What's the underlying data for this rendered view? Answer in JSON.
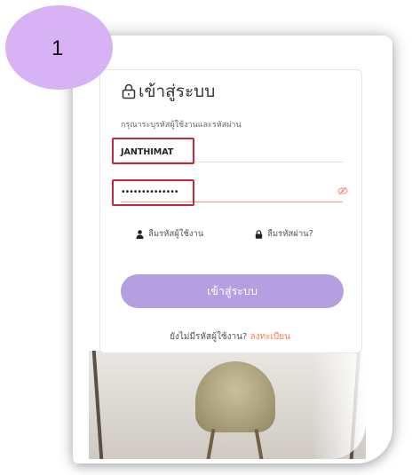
{
  "step": {
    "number": "1"
  },
  "login": {
    "title": "เข้าสู่ระบบ",
    "subtitle": "กรุณาระบุรหัสผู้ใช้งานและรหัสผ่าน",
    "username_value": "JANTHIMAT",
    "password_value": "••••••••••••••",
    "forgot_username": "ลืมรหัสผู้ใช้งาน",
    "forgot_password": "ลืมรหัสผ่าน?",
    "submit_label": "เข้าสู่ระบบ",
    "no_account_text": "ยังไม่มีรหัสผู้ใช้งาน?",
    "register_link": "ลงทะเบียน"
  },
  "colors": {
    "accent": "#b59fe0",
    "badge": "#d7b3f6",
    "highlight": "#c4283f",
    "link": "#ff7a59",
    "focus_underline": "#f1a07a"
  },
  "icons": {
    "title": "lock-icon",
    "password_toggle": "eye-slash-icon",
    "forgot_username": "user-icon",
    "forgot_password": "lock-small-icon"
  }
}
